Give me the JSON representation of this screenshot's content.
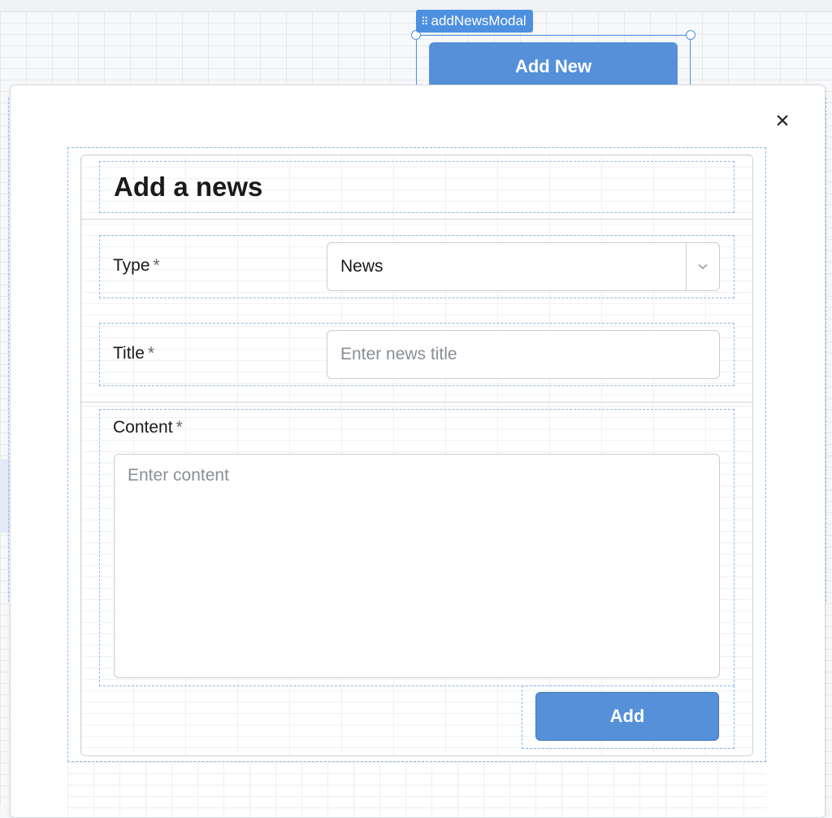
{
  "widget": {
    "name": "addNewsModal",
    "trigger_button_label": "Add New"
  },
  "modal": {
    "close_symbol": "×",
    "form": {
      "title": "Add a news",
      "required_marker": "*",
      "type": {
        "label": "Type",
        "selected_value": "News"
      },
      "title_field": {
        "label": "Title",
        "placeholder": "Enter news title"
      },
      "content": {
        "label": "Content",
        "placeholder": "Enter content"
      },
      "submit_label": "Add"
    }
  },
  "colors": {
    "accent": "#5590d9",
    "selection": "#4e90e0",
    "dashed_outline": "#8db8ea"
  }
}
